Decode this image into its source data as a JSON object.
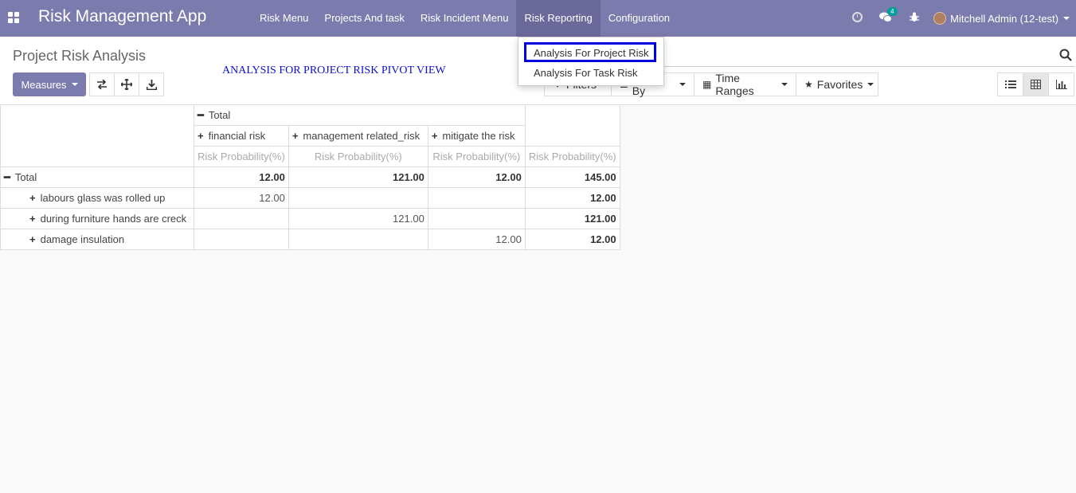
{
  "app": {
    "title": "Risk Management App"
  },
  "menu": [
    "Risk Menu",
    "Projects And task",
    "Risk Incident Menu",
    "Risk Reporting",
    "Configuration"
  ],
  "systray": {
    "chat_badge": "4",
    "user": "Mitchell Admin (12-test)"
  },
  "page": {
    "title": "Project Risk Analysis",
    "annotation": "ANALYSIS FOR PROJECT RISK PIVOT VIEW"
  },
  "toolbar": {
    "measures": "Measures"
  },
  "search": {
    "buttons": [
      "Filters",
      "Group By",
      "Time Ranges",
      "Favorites"
    ]
  },
  "dropdown": {
    "items": [
      "Analysis For Project Risk",
      "Analysis For Task Risk"
    ]
  },
  "pivot": {
    "col_total": "Total",
    "col_groups": [
      "financial risk",
      "management related_risk",
      "mitigate the risk"
    ],
    "measure": "Risk Probability(%)",
    "row_total": "Total",
    "totals_row": [
      "12.00",
      "121.00",
      "12.00",
      "145.00"
    ],
    "rows": [
      {
        "label": "labours glass was rolled up",
        "values": [
          "12.00",
          "",
          "",
          "12.00"
        ]
      },
      {
        "label": "during furniture hands are creck",
        "values": [
          "",
          "121.00",
          "",
          "121.00"
        ]
      },
      {
        "label": "damage insulation",
        "values": [
          "",
          "",
          "12.00",
          "12.00"
        ]
      }
    ]
  },
  "colors": {
    "navbar": "#7c7bad",
    "highlight": "#0000dd",
    "annotation": "#1010cc"
  }
}
